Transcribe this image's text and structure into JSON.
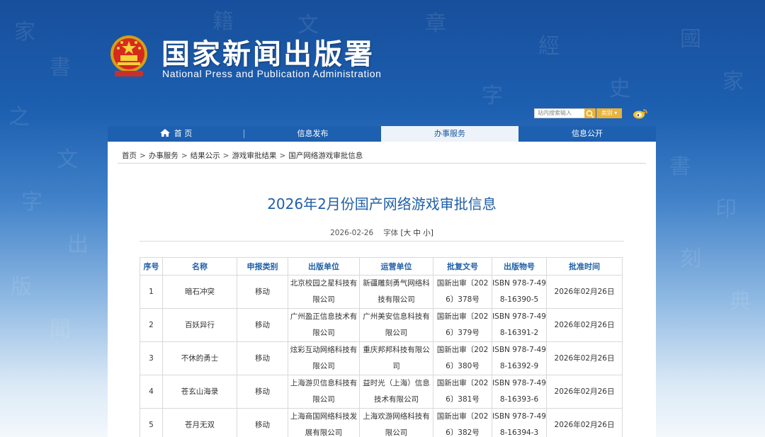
{
  "header": {
    "title": "国家新闻出版署",
    "subtitle": "National Press and Publication Administration",
    "search_placeholder": "站内搜索输入",
    "category_label": "类别 ▾"
  },
  "nav": {
    "items": [
      {
        "label": "首 页",
        "active": false
      },
      {
        "label": "信息发布",
        "active": false
      },
      {
        "label": "办事服务",
        "active": true
      },
      {
        "label": "信息公开",
        "active": false
      }
    ]
  },
  "breadcrumb": [
    "首页",
    "办事服务",
    "结果公示",
    "游戏审批结果",
    "国产网络游戏审批信息"
  ],
  "article": {
    "title": "2026年2月份国产网络游戏审批信息",
    "date": "2026-02-26",
    "font_size_label": "字体",
    "font_size_options": "[大 中 小]"
  },
  "table": {
    "headers": [
      "序号",
      "名称",
      "申报类别",
      "出版单位",
      "运营单位",
      "批复文号",
      "出版物号",
      "批准时间"
    ],
    "rows": [
      [
        "1",
        "暗石冲突",
        "移动",
        "北京校园之星科技有限公司",
        "新疆雕刻勇气网络科技有限公司",
        "国新出审〔2026〕378号",
        "ISBN 978-7-498-16390-5",
        "2026年02月26日"
      ],
      [
        "2",
        "百妖异行",
        "移动",
        "广州盈正信息技术有限公司",
        "广州美安信息科技有限公司",
        "国新出审〔2026〕379号",
        "ISBN 978-7-498-16391-2",
        "2026年02月26日"
      ],
      [
        "3",
        "不休的勇士",
        "移动",
        "炫彩互动网络科技有限公司",
        "重庆邦邦科技有限公司",
        "国新出审〔2026〕380号",
        "ISBN 978-7-498-16392-9",
        "2026年02月26日"
      ],
      [
        "4",
        "苍玄山海录",
        "移动",
        "上海游贝信息科技有限公司",
        "益时光（上海）信息技术有限公司",
        "国新出审〔2026〕381号",
        "ISBN 978-7-498-16393-6",
        "2026年02月26日"
      ],
      [
        "5",
        "苍月无双",
        "移动",
        "上海商国网络科技发展有限公司",
        "上海欢游网络科技有限公司",
        "国新出审〔2026〕382号",
        "ISBN 978-7-498-16394-3",
        "2026年02月26日"
      ]
    ]
  },
  "colors": {
    "brand_blue": "#1e60b0",
    "title_blue": "#1f5fa8",
    "accent_gold": "#e9b23a"
  }
}
